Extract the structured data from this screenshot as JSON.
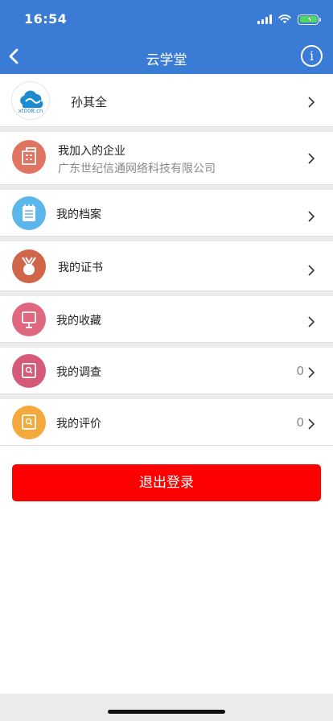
{
  "status_bar": {
    "time": "16:54"
  },
  "nav": {
    "title": "云学堂",
    "info_glyph": "i",
    "back_icon": "chevron-left-icon"
  },
  "profile": {
    "name": "孙其全",
    "logo_text": "xt008.cn"
  },
  "menu": [
    {
      "label": "我加入的企业",
      "subtitle": "广东世纪信通网络科技有限公司",
      "icon": "building-icon",
      "color": "#e17461"
    },
    {
      "label": "我的档案",
      "icon": "notepad-icon",
      "color": "#5bb6e9"
    },
    {
      "label": "我的证书",
      "icon": "medal-icon",
      "color": "#d0654a"
    },
    {
      "label": "我的收藏",
      "icon": "board-icon",
      "color": "#e0687e"
    },
    {
      "label": "我的调查",
      "count": "0",
      "icon": "survey-icon",
      "color": "#d65a78"
    },
    {
      "label": "我的评价",
      "count": "0",
      "icon": "review-icon",
      "color": "#f4a93d"
    }
  ],
  "logout_label": "退出登录",
  "colors": {
    "header": "#3a7bd5",
    "logout": "#ff0000",
    "battery": "#4cd964"
  }
}
